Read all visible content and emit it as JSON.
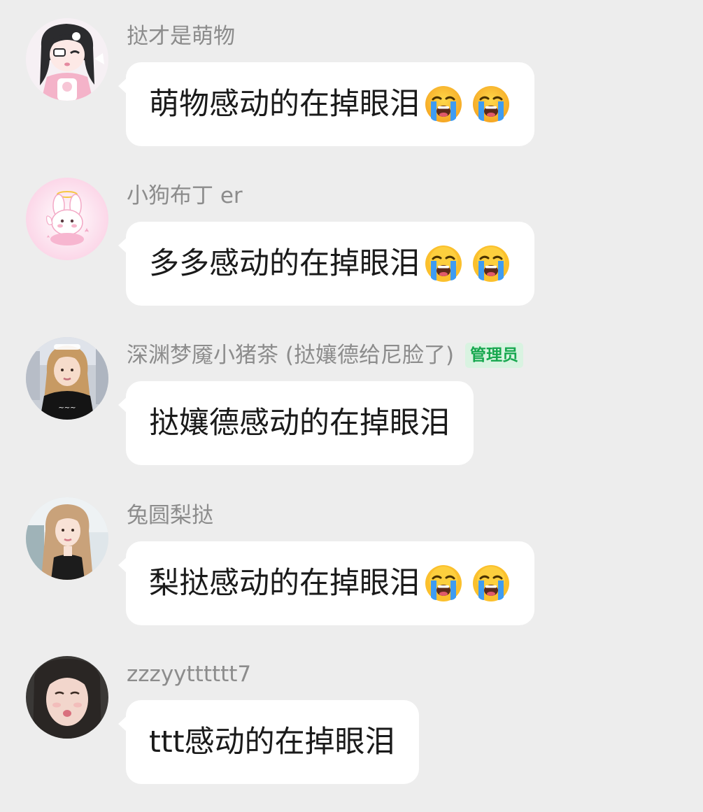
{
  "messages": [
    {
      "sender": "挞才是萌物",
      "text": "萌物感动的在掉眼泪",
      "emoji_count": 2,
      "emoji_icon": "loudly-crying-face",
      "avatar_icon": "anime-girl-avatar",
      "role_badge": null
    },
    {
      "sender": "小狗布丁 er",
      "text": "多多感动的在掉眼泪",
      "emoji_count": 2,
      "emoji_icon": "loudly-crying-face",
      "avatar_icon": "bunny-angel-avatar",
      "role_badge": null
    },
    {
      "sender": "深渊梦魇小猪茶 (挞孃德给尼脸了)",
      "text": "挞孃德感动的在掉眼泪",
      "emoji_count": 0,
      "emoji_icon": null,
      "avatar_icon": "girl-photo-avatar",
      "role_badge": "管理员"
    },
    {
      "sender": "兔圆梨挞",
      "text": "梨挞感动的在掉眼泪",
      "emoji_count": 2,
      "emoji_icon": "loudly-crying-face",
      "avatar_icon": "girl-portrait-avatar",
      "role_badge": null
    },
    {
      "sender": "zzzyytttttt7",
      "text": "ttt感动的在掉眼泪",
      "emoji_count": 0,
      "emoji_icon": null,
      "avatar_icon": "selfie-avatar",
      "role_badge": null
    }
  ],
  "colors": {
    "background": "#ededed",
    "bubble": "#ffffff",
    "sender_name": "#8c8c8c",
    "message_text": "#1a1a1a",
    "badge_bg": "#d9f3e1",
    "badge_text": "#17a84f"
  }
}
